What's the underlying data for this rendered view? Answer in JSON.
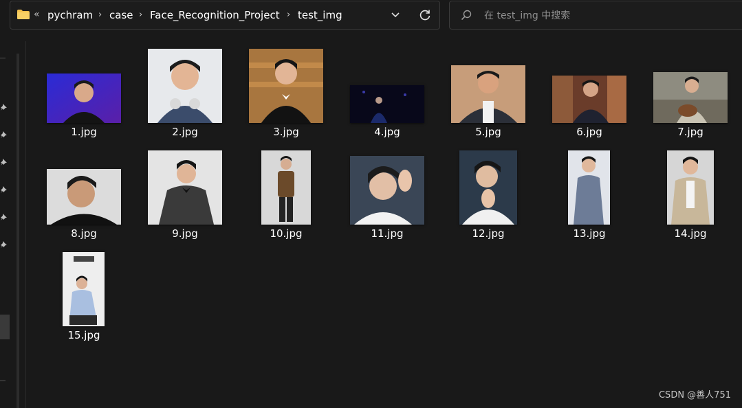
{
  "breadcrumb": {
    "overflow": "«",
    "items": [
      "pychram",
      "case",
      "Face_Recognition_Project",
      "test_img"
    ]
  },
  "search": {
    "placeholder": "在 test_img 中搜索"
  },
  "files": [
    {
      "name": "1.jpg",
      "icon": "portrait-thumbnail"
    },
    {
      "name": "2.jpg",
      "icon": "portrait-thumbnail"
    },
    {
      "name": "3.jpg",
      "icon": "portrait-thumbnail"
    },
    {
      "name": "4.jpg",
      "icon": "portrait-thumbnail"
    },
    {
      "name": "5.jpg",
      "icon": "portrait-thumbnail"
    },
    {
      "name": "6.jpg",
      "icon": "portrait-thumbnail"
    },
    {
      "name": "7.jpg",
      "icon": "portrait-thumbnail"
    },
    {
      "name": "8.jpg",
      "icon": "portrait-thumbnail"
    },
    {
      "name": "9.jpg",
      "icon": "portrait-thumbnail"
    },
    {
      "name": "10.jpg",
      "icon": "portrait-thumbnail"
    },
    {
      "name": "11.jpg",
      "icon": "portrait-thumbnail"
    },
    {
      "name": "12.jpg",
      "icon": "portrait-thumbnail"
    },
    {
      "name": "13.jpg",
      "icon": "portrait-thumbnail"
    },
    {
      "name": "14.jpg",
      "icon": "portrait-thumbnail"
    },
    {
      "name": "15.jpg",
      "icon": "portrait-thumbnail"
    }
  ],
  "watermark": "CSDN @善人751",
  "colors": {
    "background": "#191919",
    "folder": "#f2c14e",
    "text": "#ffffff"
  }
}
